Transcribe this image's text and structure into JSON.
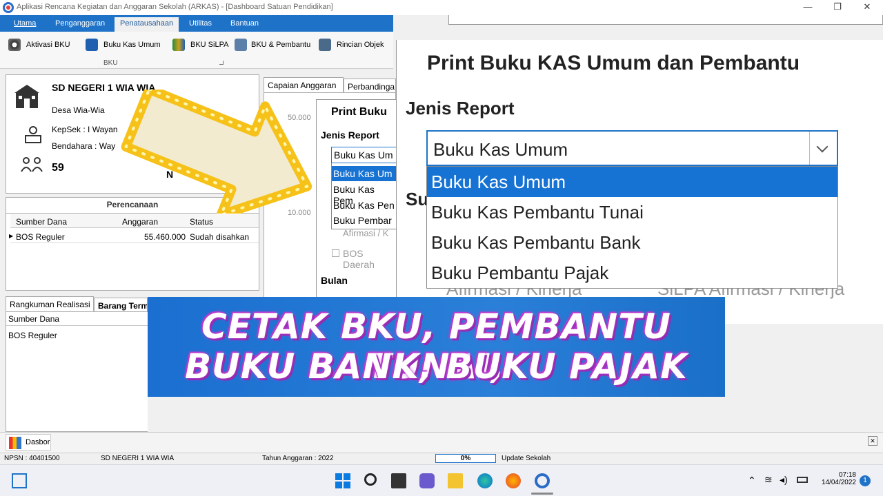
{
  "window": {
    "title": "Aplikasi Rencana Kegiatan dan Anggaran Sekolah (ARKAS) - [Dashboard Satuan Pendidikan]",
    "minimize": "—",
    "maximize": "❐",
    "close": "✕"
  },
  "menu": [
    "Utama",
    "Penganggaran",
    "Penatausahaan",
    "Utilitas",
    "Bantuan"
  ],
  "toolbar": {
    "items": [
      "Aktivasi BKU",
      "Buku Kas Umum",
      "BKU SiLPA",
      "BKU & Pembantu",
      "Rincian Objek"
    ],
    "group_label": "BKU"
  },
  "school": {
    "name": "SD NEGERI 1 WIA WIA",
    "village": "Desa Wia-Wia",
    "kepsek": "KepSek : I Wayan",
    "bendahara": "Bendahara : Way",
    "count": "59",
    "partial": "N"
  },
  "perencanaan": {
    "title": "Perencanaan",
    "headers": [
      "Sumber Dana",
      "Anggaran",
      "Status"
    ],
    "row": [
      "BOS Reguler",
      "55.460.000",
      "Sudah disahkan"
    ]
  },
  "realisasi": {
    "tabs": [
      "Rangkuman Realisasi",
      "Barang Term"
    ],
    "header": "Sumber Dana",
    "row": "BOS Reguler"
  },
  "middle": {
    "tabs": [
      "Capaian Anggaran",
      "Perbandinga"
    ],
    "axis": [
      "50.000",
      "10.000"
    ],
    "dialog_title": "Print Buku",
    "jenis": "Jenis Report",
    "options": [
      "Buku Kas Um",
      "Buku Kas Um",
      "Buku Kas Pem",
      "Buku Kas Pen",
      "Buku Pembar"
    ],
    "faded1": "Afirmasi / K",
    "faded2": "BOS Daerah",
    "bulan": "Bulan"
  },
  "zoom_dialog": {
    "title": "Print Buku KAS Umum dan Pembantu",
    "jenis_label": "Jenis Report",
    "selected": "Buku Kas Umum",
    "options": [
      "Buku Kas Umum",
      "Buku Kas Pembantu Tunai",
      "Buku Kas Pembantu Bank",
      "Buku Pembantu Pajak"
    ],
    "partial_label": "Su",
    "faded_left": "Afirmasi / Kinerja",
    "faded_right": "SiLPA Afirmasi / Kinerja"
  },
  "banner": {
    "line1": "CETAK BKU, PEMBANTU TUNAI,",
    "line2": "BUKU BANK, BUKU PAJAK"
  },
  "dasbor": "Dasbor",
  "status": {
    "npsn": "NPSN : 40401500",
    "school": "SD NEGERI 1 WIA WIA",
    "tahun": "Tahun Anggaran : 2022",
    "progress": "0%",
    "update": "Update Sekolah"
  },
  "tray": {
    "time": "07:18",
    "date": "14/04/2022",
    "notifications": "1"
  },
  "colors": {
    "accent": "#1e73c9",
    "highlight": "#1773d3",
    "banner_glow": "#c53bd8"
  }
}
